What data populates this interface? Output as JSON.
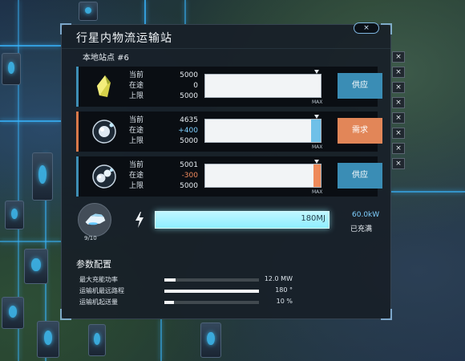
{
  "panel": {
    "title": "行星内物流运输站",
    "close_label": "×",
    "station_label": "本地站点 #6"
  },
  "rows": [
    {
      "item": "yellow-crystal-icon",
      "labels": [
        "当前",
        "在途",
        "上限"
      ],
      "current": "5000",
      "in_transit": "0",
      "limit": "5000",
      "fill_fraction": 0,
      "max_label": "MAX",
      "mode": "供应",
      "accent_color": "#3e8eb5"
    },
    {
      "item": "orb-icon",
      "labels": [
        "当前",
        "在途",
        "上限"
      ],
      "current": "4635",
      "in_transit": "+400",
      "limit": "5000",
      "fill_fraction": 0.08,
      "max_label": "MAX",
      "mode": "需求",
      "accent_color": "#d9794a"
    },
    {
      "item": "twin-orb-icon",
      "labels": [
        "当前",
        "在途",
        "上限"
      ],
      "current": "5001",
      "in_transit": "-300",
      "limit": "5000",
      "fill_fraction": 0.06,
      "max_label": "MAX",
      "mode": "供应",
      "accent_color": "#3e8eb5"
    }
  ],
  "side_buttons": [
    "×",
    "×",
    "×",
    "×",
    "×",
    "×",
    "×",
    "×"
  ],
  "logistics": {
    "drone_count": "9/10",
    "energy": "180MJ",
    "power": "60.0kW",
    "charge_status": "已充满"
  },
  "params": {
    "title": "参数配置",
    "items": [
      {
        "label": "最大充能功率",
        "value": "12.0 MW",
        "fill_fraction": 0.12
      },
      {
        "label": "运输机最远路程",
        "value": "180 °",
        "fill_fraction": 1.0
      },
      {
        "label": "运输机起送量",
        "value": "10 %",
        "fill_fraction": 0.1
      }
    ]
  },
  "colors": {
    "supply": "#3a8db5",
    "demand": "#e28658",
    "energy": "#9ff0ff",
    "accent_text": "#7fd0ff"
  }
}
